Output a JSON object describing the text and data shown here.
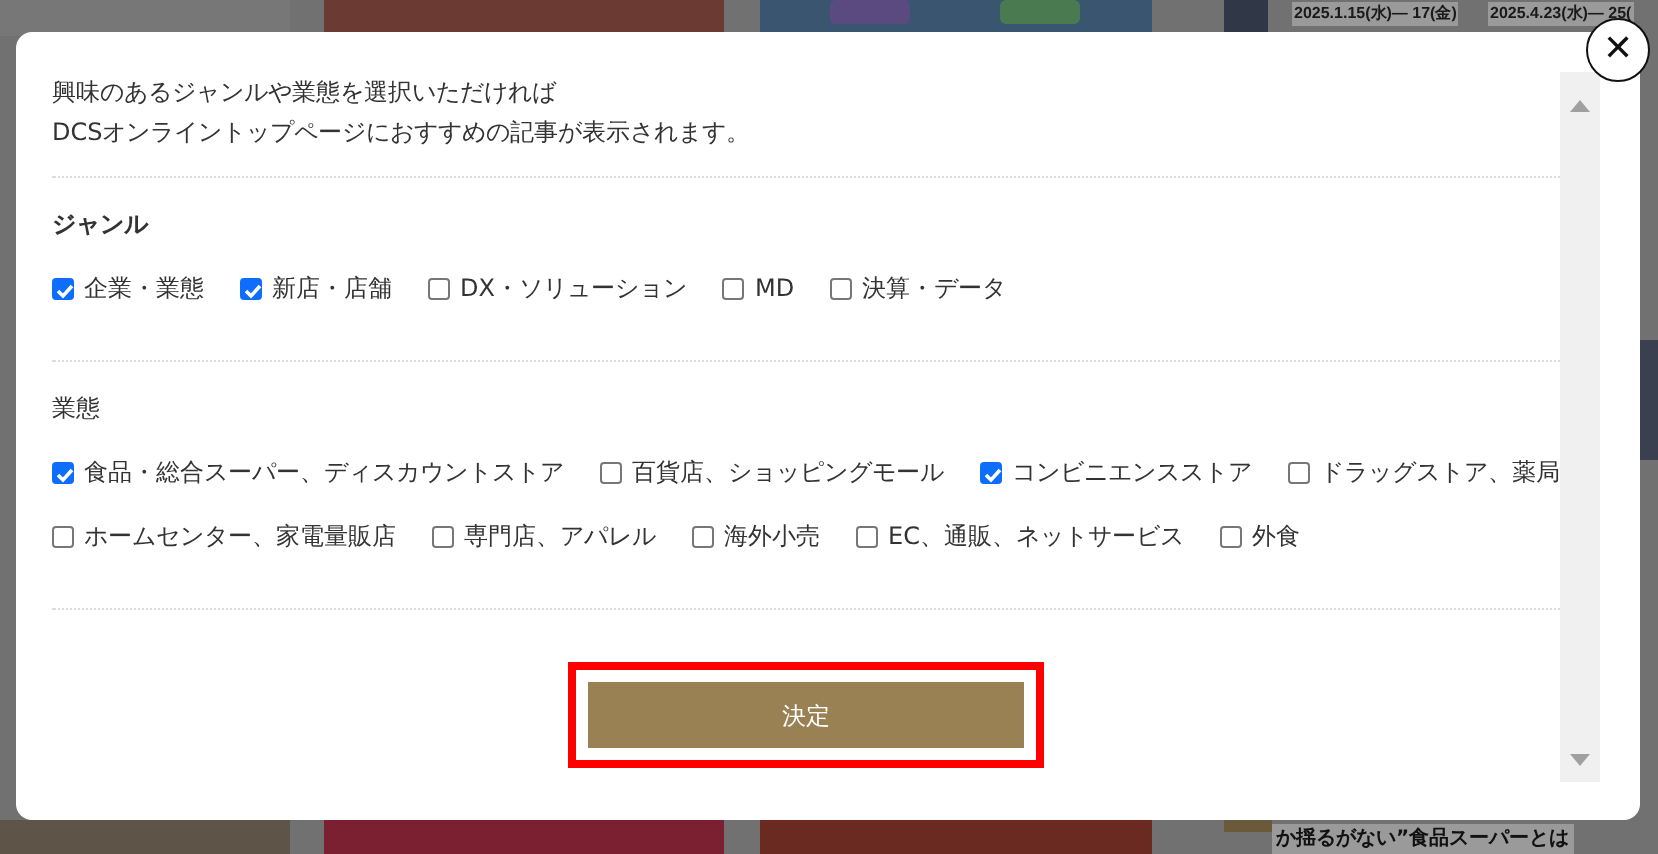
{
  "background": {
    "dates": [
      "2025.1.15(水)— 17(金)",
      "2025.4.23(水)— 25("
    ],
    "headline": "か揺るがない”食品スーパーとは"
  },
  "modal": {
    "intro": [
      "興味のあるジャンルや業態を選択いただければ",
      "DCSオンライントップページにおすすめの記事が表示されます。"
    ],
    "sections": [
      {
        "title": "ジャンル",
        "bold": true,
        "options": [
          {
            "label": "企業・業態",
            "checked": true
          },
          {
            "label": "新店・店舗",
            "checked": true
          },
          {
            "label": "DX・ソリューション",
            "checked": false
          },
          {
            "label": "MD",
            "checked": false
          },
          {
            "label": "決算・データ",
            "checked": false
          }
        ]
      },
      {
        "title": "業態",
        "bold": false,
        "options": [
          {
            "label": "食品・総合スーパー、ディスカウントストア",
            "checked": true
          },
          {
            "label": "百貨店、ショッピングモール",
            "checked": false
          },
          {
            "label": "コンビニエンスストア",
            "checked": true
          },
          {
            "label": "ドラッグストア、薬局",
            "checked": false
          },
          {
            "label": "ホームセンター、家電量販店",
            "checked": false
          },
          {
            "label": "専門店、アパレル",
            "checked": false
          },
          {
            "label": "海外小売",
            "checked": false
          },
          {
            "label": "EC、通販、ネットサービス",
            "checked": false
          },
          {
            "label": "外食",
            "checked": false
          }
        ]
      }
    ],
    "submit": {
      "label": "決定",
      "highlighted": true
    },
    "close": {
      "label": "✕"
    }
  }
}
